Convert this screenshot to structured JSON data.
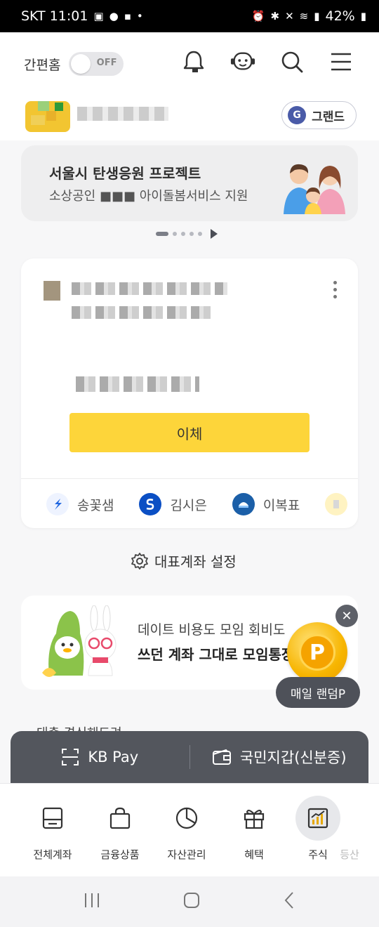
{
  "status_bar": {
    "carrier_time": "SKT 11:01",
    "battery": "42%"
  },
  "header": {
    "easy_mode_label": "간편홈",
    "toggle_label": "OFF"
  },
  "profile": {
    "grade_letter": "G",
    "grade_label": "그랜드"
  },
  "banner": {
    "title": "서울시 탄생응원 프로젝트",
    "subtitle": "소상공인 ■■■ 아이돌봄서비스 지원"
  },
  "account": {
    "transfer_label": "이체",
    "contacts": [
      {
        "name": "송꽃샘",
        "color": "#1f66e0"
      },
      {
        "name": "김시은",
        "color": "#0b4fc4"
      },
      {
        "name": "이복표",
        "color": "#1b5fa8"
      }
    ]
  },
  "representative_account": "대표계좌 설정",
  "promo": {
    "line1": "데이트 비용도 모임 회비도",
    "line2": "쓰던 계좌 그대로 모임통장"
  },
  "random_point": {
    "coin_letter": "P",
    "label": "매일 랜덤P"
  },
  "peek_text": "대출 경신해드려",
  "pay_bar": {
    "kbpay": "KB Pay",
    "wallet": "국민지갑(신분증)"
  },
  "bottom_nav": [
    {
      "label": "전체계좌"
    },
    {
      "label": "금융상품"
    },
    {
      "label": "자산관리"
    },
    {
      "label": "혜택"
    },
    {
      "label": "주식"
    },
    {
      "label": "등산"
    }
  ],
  "colors": {
    "accent_yellow": "#fdd53a",
    "dark_bar": "#53565d"
  }
}
